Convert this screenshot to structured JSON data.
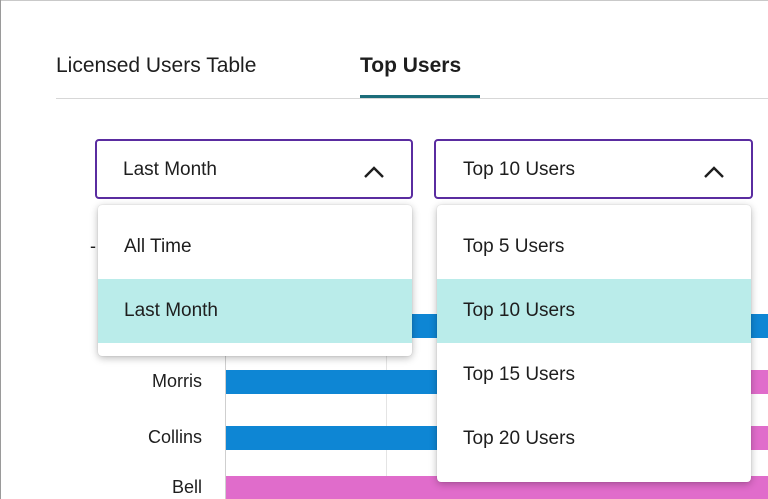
{
  "tabs": [
    {
      "label": "Licensed Users Table",
      "active": false
    },
    {
      "label": "Top Users",
      "active": true
    }
  ],
  "time_filter": {
    "selected": "Last Month",
    "options": [
      "All Time",
      "Last Month"
    ]
  },
  "users_filter": {
    "selected": "Top 10 Users",
    "options": [
      "Top 5 Users",
      "Top 10 Users",
      "Top 15 Users",
      "Top 20 Users"
    ]
  },
  "chart": {
    "visible_user_labels": [
      "Morris",
      "Collins",
      "Bell"
    ]
  },
  "colors": {
    "accent_border": "#5a2ca0",
    "tab_underline": "#1b6d7a",
    "selected_option": "#baecea",
    "bar_blue": "#0e86d4",
    "bar_pink": "#e06ccb"
  }
}
